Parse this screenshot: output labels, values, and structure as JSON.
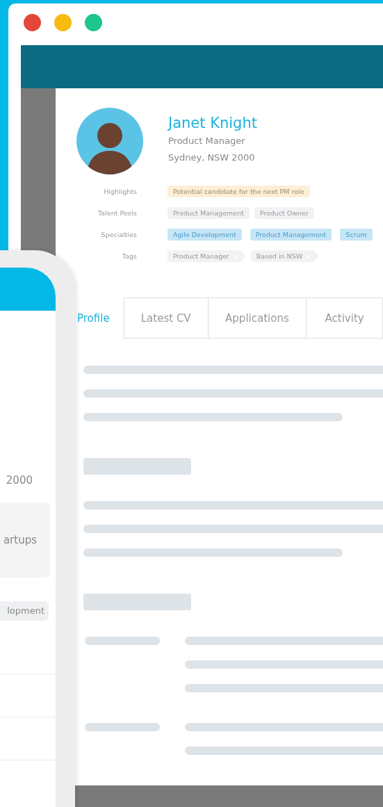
{
  "profile": {
    "name": "Janet Knight",
    "title": "Product Manager",
    "location": "Sydney, NSW 2000"
  },
  "fields": [
    {
      "label": "Highlights",
      "kind": "highlight",
      "chips": [
        "Potential candidate for the next PM role"
      ]
    },
    {
      "label": "Talent Pools",
      "kind": "pool",
      "chips": [
        "Product Management",
        "Product Owner"
      ]
    },
    {
      "label": "Specialties",
      "kind": "specialty",
      "chips": [
        "Agile Development",
        "Product Management",
        "Scrum"
      ]
    },
    {
      "label": "Tags",
      "kind": "tag",
      "chips": [
        "Product Manager",
        "Based in NSW"
      ]
    }
  ],
  "tabs": [
    {
      "label": "Profile",
      "selected": true
    },
    {
      "label": "Latest CV",
      "selected": false
    },
    {
      "label": "Applications",
      "selected": false
    },
    {
      "label": "Activity",
      "selected": false
    }
  ],
  "phone": {
    "location": "2000",
    "card_text": "artups",
    "tag": "lopment"
  }
}
